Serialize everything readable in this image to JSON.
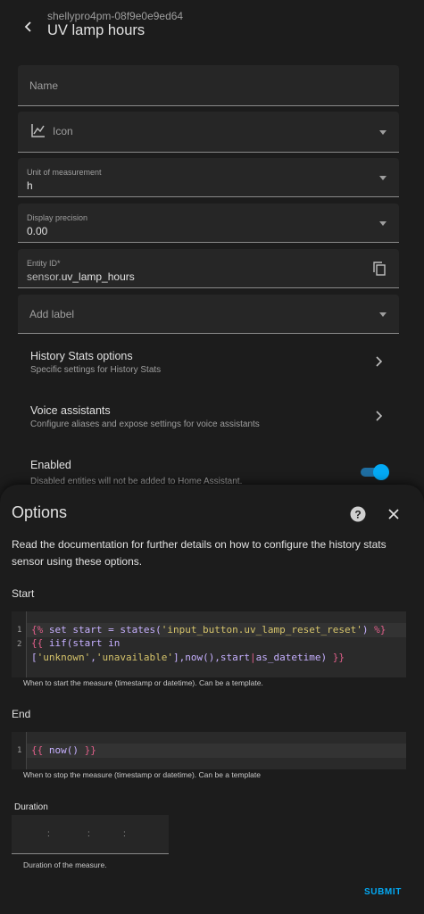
{
  "header": {
    "subtitle": "shellypro4pm-08f9e0e9ed64",
    "title": "UV lamp hours"
  },
  "fields": {
    "name_label": "Name",
    "icon_label": "Icon",
    "unit_label": "Unit of measurement",
    "unit_value": "h",
    "precision_label": "Display precision",
    "precision_value": "0.00",
    "entity_id_label": "Entity ID*",
    "entity_id_prefix": "sensor.",
    "entity_id_value": "uv_lamp_hours",
    "add_label": "Add label"
  },
  "rows": {
    "history_title": "History Stats options",
    "history_sub": "Specific settings for History Stats",
    "voice_title": "Voice assistants",
    "voice_sub": "Configure aliases and expose settings for voice assistants",
    "enabled_title": "Enabled",
    "enabled_sub": "Disabled entities will not be added to Home Assistant."
  },
  "enabled_toggle": {
    "on": true
  },
  "icons": {
    "back": "arrow-left-icon",
    "icon_field": "chart-line-icon",
    "copy": "copy-icon",
    "chevron": "chevron-right-icon",
    "help": "help-circle-icon",
    "close": "close-icon"
  },
  "colors": {
    "accent": "#03a9f4",
    "background": "#1c1c1c",
    "field": "#262626",
    "code_keyword": "#e05f8a",
    "code_string": "#d6c46b"
  },
  "options": {
    "title": "Options",
    "description": "Read the documentation for further details on how to configure the history stats sensor using these options.",
    "start_label": "Start",
    "start_code": {
      "l1_open": "{%",
      "l1_mid": " set start = states(",
      "l1_str": "'input_button.uv_lamp_reset_reset'",
      "l1_close": ") ",
      "l1_end": "%}",
      "l2_open": "{{",
      "l2_rest": " iif(start in",
      "l3_a": "[",
      "l3_s1": "'unknown'",
      "l3_b": ",",
      "l3_s2": "'unavailable'",
      "l3_c": "],now(),start",
      "l3_pipe": "|",
      "l3_d": "as_datetime) ",
      "l3_end": "}}"
    },
    "start_hint": "When to start the measure (timestamp or datetime). Can be a template.",
    "end_label": "End",
    "end_code": {
      "open": "{{",
      "mid": " now() ",
      "close": "}}"
    },
    "end_hint": "When to stop the measure (timestamp or datetime). Can be a template",
    "duration_label": "Duration",
    "duration_hint": "Duration of the measure.",
    "submit_label": "SUBMIT"
  }
}
